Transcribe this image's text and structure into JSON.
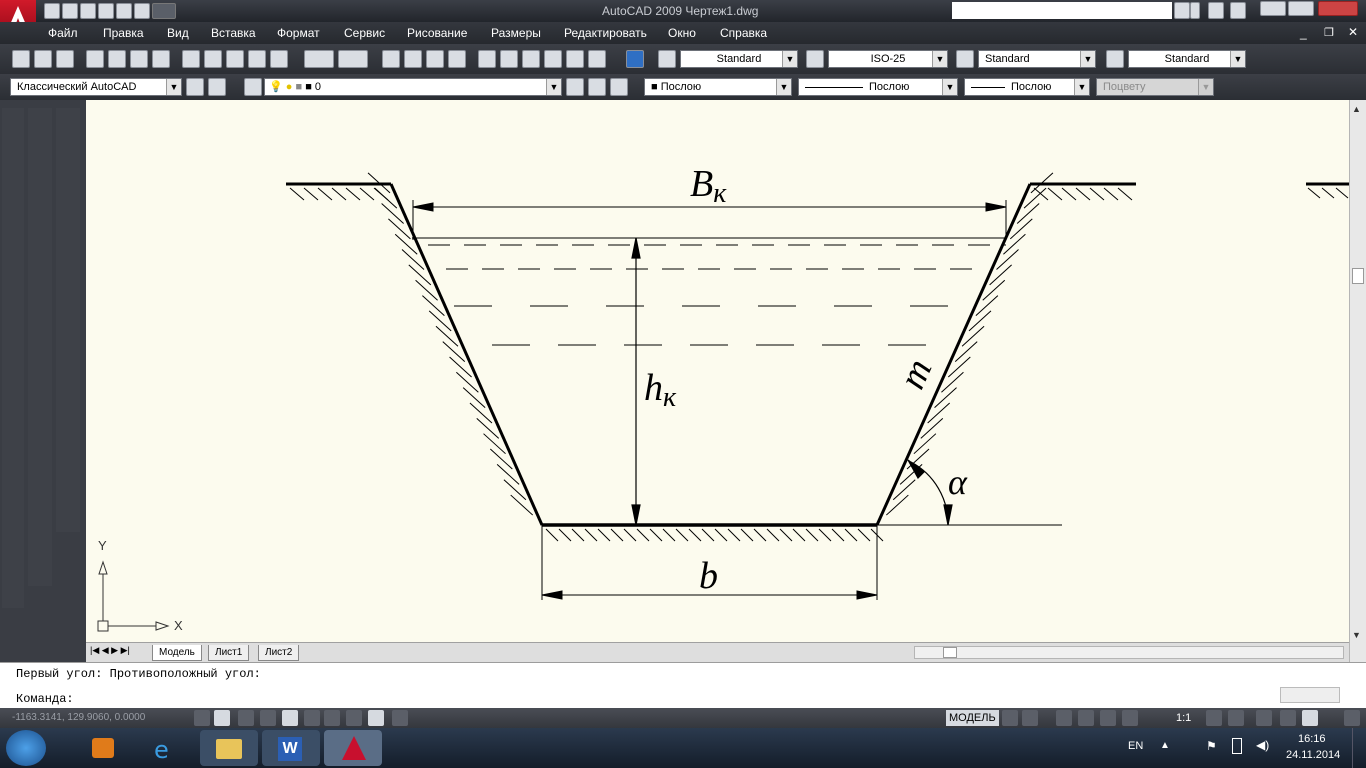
{
  "window": {
    "title": "AutoCAD 2009 Чертеж1.dwg",
    "blurred_title": "..."
  },
  "menu": [
    "Файл",
    "Правка",
    "Вид",
    "Вставка",
    "Формат",
    "Сервис",
    "Рисование",
    "Размеры",
    "Редактировать",
    "Окно",
    "Справка"
  ],
  "styles": {
    "text_style": "Standard",
    "dim_style": "ISO-25",
    "table_style": "Standard",
    "mleader_style": "Standard"
  },
  "workspace": "Классический AutoCAD",
  "layer": "0",
  "properties": {
    "color": "Послою",
    "linetype": "Послою",
    "lineweight": "Послою",
    "plotstyle": "Поцвету"
  },
  "drawing": {
    "label_top_width": "B",
    "label_top_width_sub": "к",
    "label_depth": "h",
    "label_depth_sub": "к",
    "label_slope": "m",
    "label_angle": "α",
    "label_bottom_width": "b",
    "ucs_x": "X",
    "ucs_y": "Y"
  },
  "tabs": [
    "Модель",
    "Лист1",
    "Лист2"
  ],
  "command": {
    "history": "Первый угол: Противоположный угол:",
    "prompt": "Команда:"
  },
  "status": {
    "coords": "-1163.3141, 129.9060, 0.0000",
    "model": "МОДЕЛЬ",
    "scale": "1:1"
  },
  "taskbar": {
    "lang": "EN",
    "time": "16:16",
    "date": "24.11.2014"
  },
  "colors": {
    "paper": "#fcfbee",
    "ui_dark": "#3a3d44",
    "autocad_red": "#c8102e"
  }
}
